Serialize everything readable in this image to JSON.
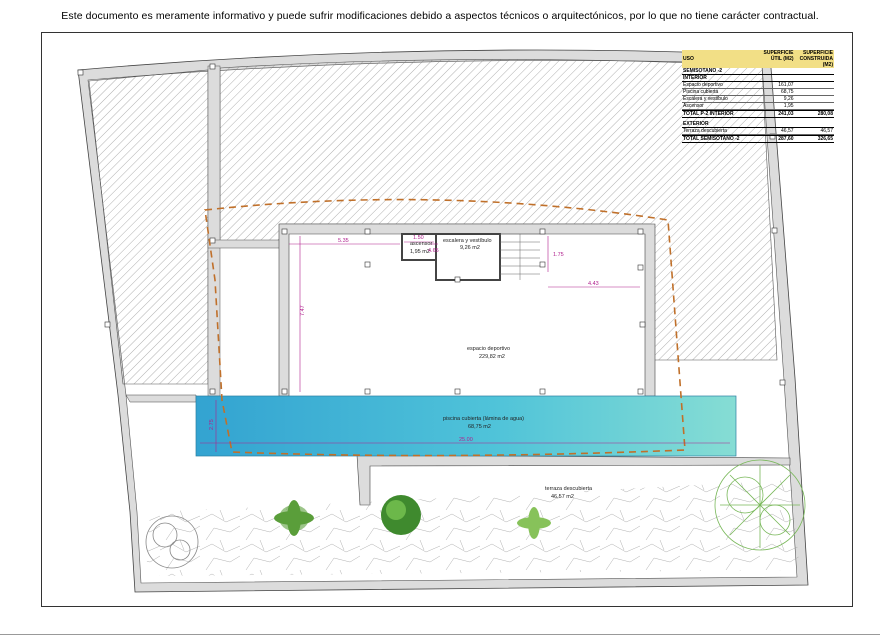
{
  "disclaimer": "Este documento es meramente informativo y puede sufrir modificaciones debido a aspectos técnicos o arquitectónicos, por lo que no tiene carácter contractual.",
  "table": {
    "col_use": "USO",
    "col_util": "SUPERFICIE ÚTIL (M2)",
    "col_construida": "SUPERFICIE CONSTRUIDA (M2)",
    "level": "SEMISOTANO -2",
    "interior_header": "INTERIOR",
    "interior_rows": [
      {
        "uso": "Espacio deportivo",
        "util": "161,07",
        "construida": ""
      },
      {
        "uso": "Piscina cubierta",
        "util": "68,75",
        "construida": ""
      },
      {
        "uso": "Escalera y vestíbulo",
        "util": "9,26",
        "construida": ""
      },
      {
        "uso": "Ascensor",
        "util": "1,95",
        "construida": ""
      }
    ],
    "interior_total": {
      "uso": "TOTAL P-2 INTERIOR",
      "util": "241,03",
      "construida": "280,08"
    },
    "exterior_header": "EXTERIOR",
    "exterior_rows": [
      {
        "uso": "Terraza descubierta",
        "util": "46,57",
        "construida": "46,57"
      }
    ],
    "grand_total": {
      "uso": "TOTAL SEMISOTANO -2",
      "util": "287,60",
      "construida": "326,65"
    }
  },
  "plan": {
    "rooms": {
      "ascensor_name": "ascensor",
      "ascensor_area": "1,95 m2",
      "escalera_name": "escalera y vestíbulo",
      "escalera_area": "9,26 m2",
      "deportivo_name": "espacio deportivo",
      "deportivo_area": "229,82 m2",
      "piscina_name": "piscina cubierta (lámina de agua)",
      "piscina_area": "68,75 m2",
      "terraza_name": "terraza descubierta",
      "terraza_area": "46,57 m2"
    },
    "dimensions": {
      "d_535": "5.35",
      "d_150": "1.50",
      "d_465": "4.65",
      "d_175": "1.75",
      "d_443": "4.43",
      "d_747": "7.47",
      "d_275": "2.75",
      "d_2500": "25.00"
    },
    "colors": {
      "wall_fill": "#d8d8d8",
      "hatch": "#666666",
      "pool_left": "#3aa9d3",
      "pool_right": "#7edad6",
      "dimension": "#b0208e",
      "boundary_dashed": "#c0702a"
    }
  }
}
